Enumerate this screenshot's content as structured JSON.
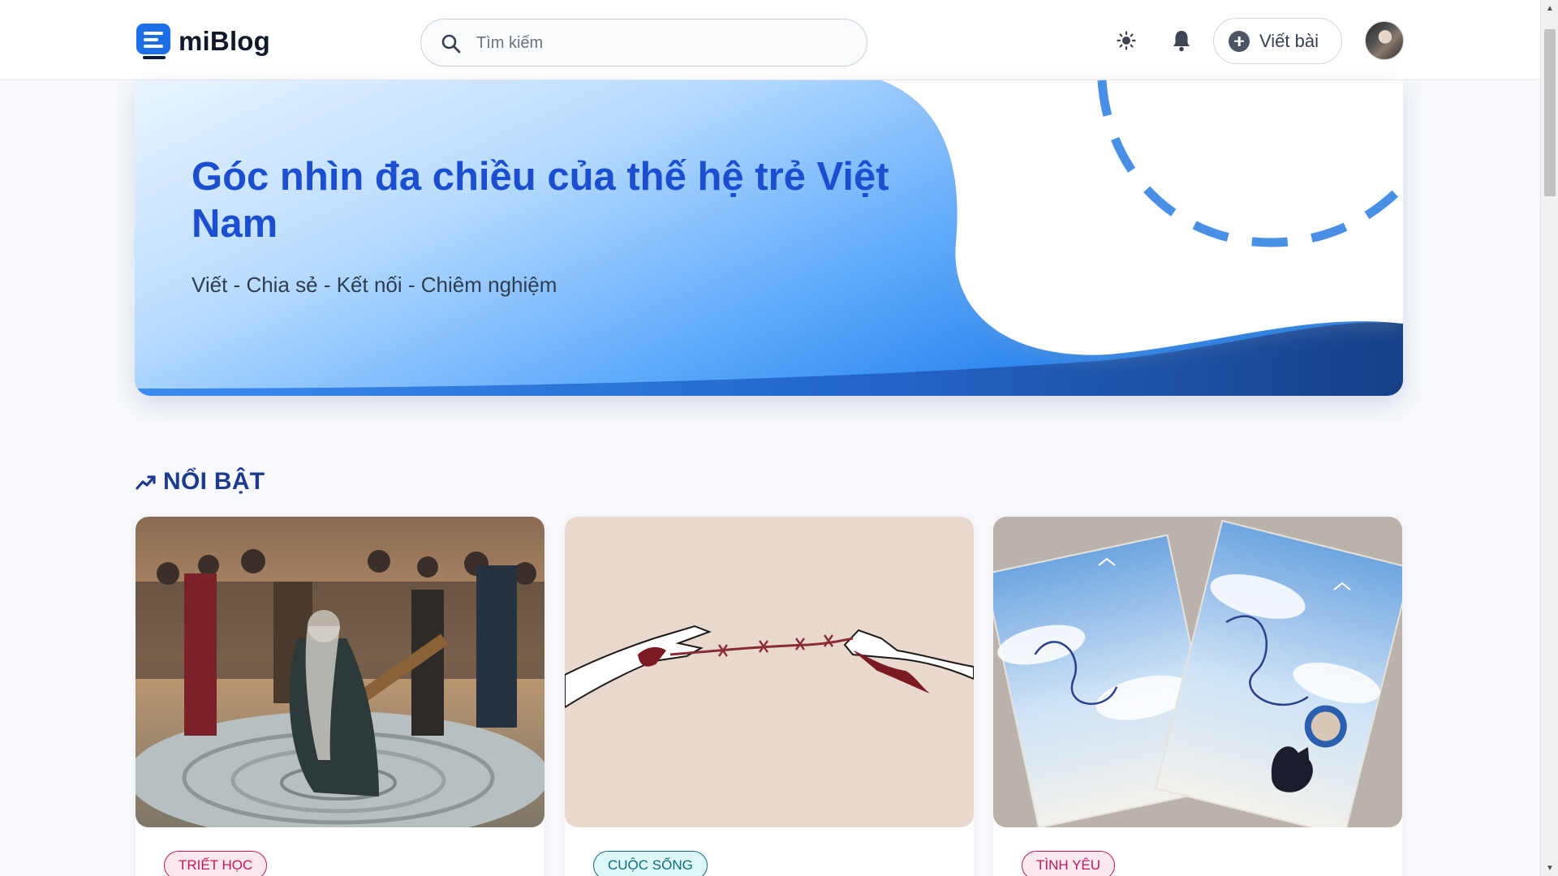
{
  "header": {
    "logo_text": "miBlog",
    "search_placeholder": "Tìm kiếm",
    "write_label": "Viết bài",
    "icons": [
      "logo-icon",
      "search-icon",
      "sun-icon",
      "bell-icon",
      "plus-circle-icon"
    ]
  },
  "hero": {
    "title": "Góc nhìn đa chiều của thế hệ trẻ Việt Nam",
    "subtitle": "Viết - Chia sẻ - Kết nối - Chiêm nghiệm"
  },
  "featured": {
    "heading": "NỔI BẬT",
    "heading_icon": "trending-up-icon",
    "cards": [
      {
        "tag": "TRIẾT HỌC",
        "image": "witch-trial-painting"
      },
      {
        "tag": "CUỘC SỐNG",
        "image": "hands-barbed-wire-illustration"
      },
      {
        "tag": "TÌNH YÊU",
        "image": "book-covers-cat-seagull"
      }
    ]
  },
  "colors": {
    "brand_blue": "#1b4fd0",
    "heading_navy": "#1e3a8a",
    "page_bg": "#f7f9fc"
  }
}
